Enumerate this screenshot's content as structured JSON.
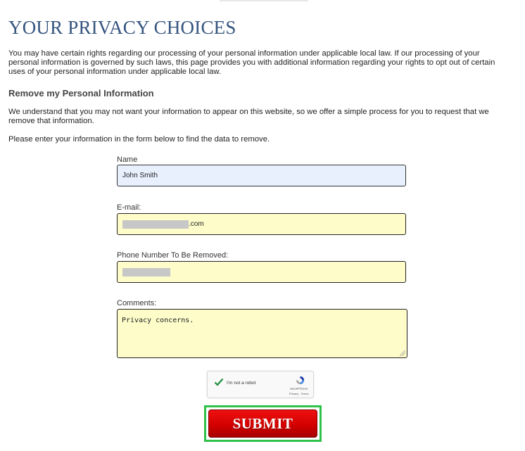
{
  "page": {
    "title": "YOUR PRIVACY CHOICES",
    "intro": "You may have certain rights regarding our processing of your personal information under applicable local law. If our processing of your personal information is governed by such laws, this page provides you with additional information regarding your rights to opt out of certain uses of your personal information under applicable local law.",
    "section_heading": "Remove my Personal Information",
    "understand": "We understand that you may not want your information to appear on this website, so we offer a simple process for you to request that we remove that information.",
    "instructions": "Please enter your information in the form below to find the data to remove."
  },
  "form": {
    "name_label": "Name",
    "name_value": "John Smith",
    "email_label": "E-mail:",
    "email_value_visible": ".com",
    "phone_label": "Phone Number To Be Removed:",
    "comments_label": "Comments:",
    "comments_value": "Privacy concerns.",
    "submit_label": "SUBMIT"
  },
  "recaptcha": {
    "label": "I'm not a robot",
    "brand": "reCAPTCHA",
    "terms": "Privacy - Terms"
  },
  "colors": {
    "title": "#35557f",
    "field_bg": "#fefdca",
    "autofill_bg": "#e8f0fe",
    "submit_red": "#d40000",
    "highlight_green": "#2fc24a"
  }
}
